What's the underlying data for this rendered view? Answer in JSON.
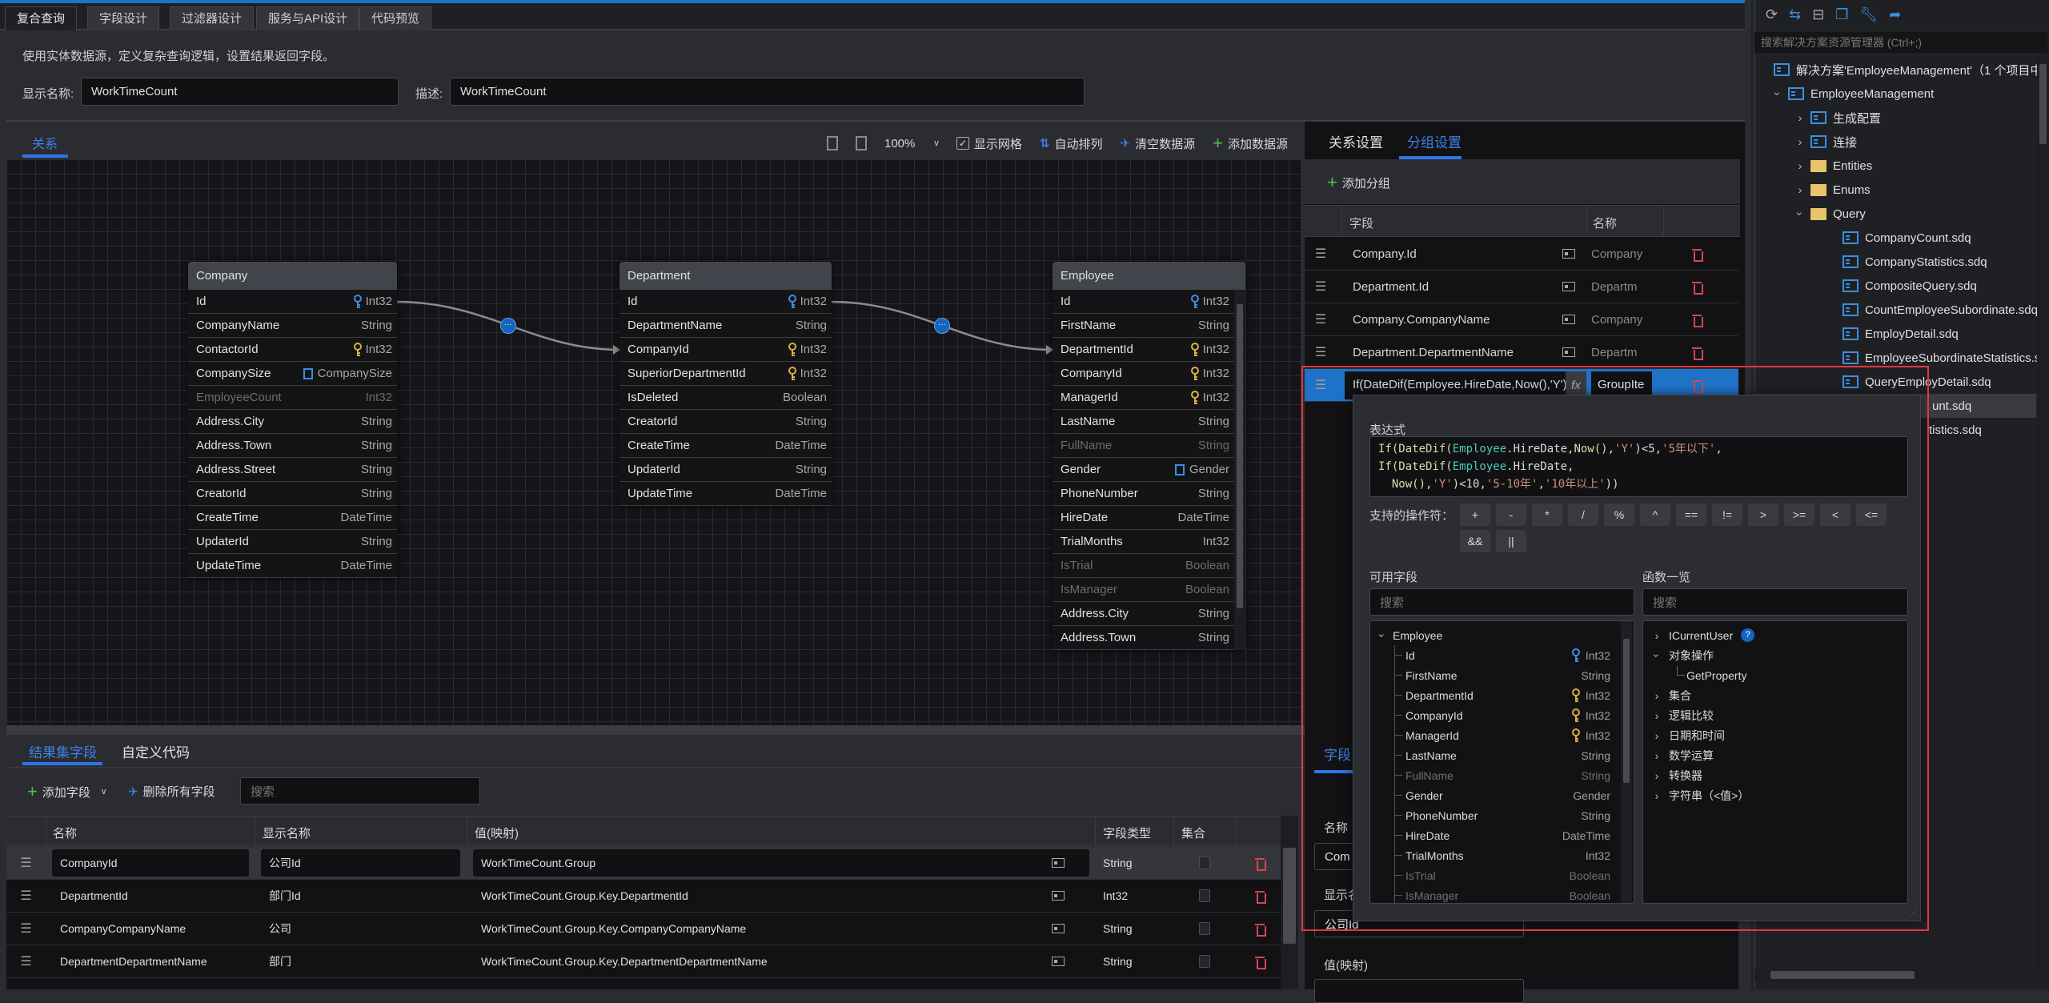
{
  "tabs": [
    "复合查询",
    "字段设计",
    "过滤器设计",
    "服务与API设计",
    "代码预览"
  ],
  "description": "使用实体数据源，定义复杂查询逻辑，设置结果返回字段。",
  "form": {
    "display_name_label": "显示名称:",
    "display_name_value": "WorkTimeCount",
    "desc_label": "描述:",
    "desc_value": "WorkTimeCount"
  },
  "canvas_toolbar": {
    "tab": "关系",
    "zoom": "100%",
    "show_grid": "显示网格",
    "show_grid_checked": true,
    "auto_arrange": "自动排列",
    "clear_sources": "清空数据源",
    "add_source": "添加数据源"
  },
  "entities": [
    {
      "title": "Company",
      "rows": [
        {
          "n": "Id",
          "t": "Int32",
          "i": "pk"
        },
        {
          "n": "CompanyName",
          "t": "String"
        },
        {
          "n": "ContactorId",
          "t": "Int32",
          "i": "fk"
        },
        {
          "n": "CompanySize",
          "t": "CompanySize",
          "i": "enum"
        },
        {
          "n": "EmployeeCount",
          "t": "Int32",
          "dim": true
        },
        {
          "n": "Address.City",
          "t": "String"
        },
        {
          "n": "Address.Town",
          "t": "String"
        },
        {
          "n": "Address.Street",
          "t": "String"
        },
        {
          "n": "CreatorId",
          "t": "String"
        },
        {
          "n": "CreateTime",
          "t": "DateTime"
        },
        {
          "n": "UpdaterId",
          "t": "String"
        },
        {
          "n": "UpdateTime",
          "t": "DateTime"
        }
      ]
    },
    {
      "title": "Department",
      "rows": [
        {
          "n": "Id",
          "t": "Int32",
          "i": "pk"
        },
        {
          "n": "DepartmentName",
          "t": "String"
        },
        {
          "n": "CompanyId",
          "t": "Int32",
          "i": "fk"
        },
        {
          "n": "SuperiorDepartmentId",
          "t": "Int32",
          "i": "fk"
        },
        {
          "n": "IsDeleted",
          "t": "Boolean"
        },
        {
          "n": "CreatorId",
          "t": "String"
        },
        {
          "n": "CreateTime",
          "t": "DateTime"
        },
        {
          "n": "UpdaterId",
          "t": "String"
        },
        {
          "n": "UpdateTime",
          "t": "DateTime"
        }
      ]
    },
    {
      "title": "Employee",
      "rows": [
        {
          "n": "Id",
          "t": "Int32",
          "i": "pk"
        },
        {
          "n": "FirstName",
          "t": "String"
        },
        {
          "n": "DepartmentId",
          "t": "Int32",
          "i": "fk"
        },
        {
          "n": "CompanyId",
          "t": "Int32",
          "i": "fk"
        },
        {
          "n": "ManagerId",
          "t": "Int32",
          "i": "fk"
        },
        {
          "n": "LastName",
          "t": "String"
        },
        {
          "n": "FullName",
          "t": "String",
          "dim": true
        },
        {
          "n": "Gender",
          "t": "Gender",
          "i": "enum"
        },
        {
          "n": "PhoneNumber",
          "t": "String"
        },
        {
          "n": "HireDate",
          "t": "DateTime"
        },
        {
          "n": "TrialMonths",
          "t": "Int32"
        },
        {
          "n": "IsTrial",
          "t": "Boolean",
          "dim": true
        },
        {
          "n": "IsManager",
          "t": "Boolean",
          "dim": true
        },
        {
          "n": "Address.City",
          "t": "String"
        },
        {
          "n": "Address.Town",
          "t": "String"
        }
      ]
    }
  ],
  "group_panel": {
    "tabs": [
      "关系设置",
      "分组设置"
    ],
    "add_group": "添加分组",
    "headers": {
      "field": "字段",
      "name": "名称"
    },
    "rows": [
      {
        "field": "Company.Id",
        "name": "Company"
      },
      {
        "field": "Department.Id",
        "name": "Departm"
      },
      {
        "field": "Company.CompanyName",
        "name": "Company"
      },
      {
        "field": "Department.DepartmentName",
        "name": "Departm"
      },
      {
        "field": "If(DateDif(Employee.HireDate,Now(),'Y')<",
        "name": "GroupIte",
        "fx": "fx",
        "selected": true
      }
    ]
  },
  "field_panel": {
    "tab": "字段",
    "name_label": "名称",
    "name_value": "Com",
    "display_label": "显示名",
    "display_value": "公司Id",
    "value_label": "值(映射)"
  },
  "expression_popup": {
    "label": "表达式",
    "tokens": [
      {
        "t": "If(DateDif(",
        "c": "fn"
      },
      {
        "t": "Employee",
        "c": "ent"
      },
      {
        "t": ".HireDate,",
        "c": "op"
      },
      {
        "t": "Now()",
        "c": "fn"
      },
      {
        "t": ",",
        "c": "op"
      },
      {
        "t": "'Y'",
        "c": "str"
      },
      {
        "t": ")<5,",
        "c": "op"
      },
      {
        "t": "'5年以下'",
        "c": "str"
      },
      {
        "t": ", ",
        "c": "op"
      },
      {
        "t": "If(DateDif(",
        "c": "fn"
      },
      {
        "t": "Employee",
        "c": "ent"
      },
      {
        "t": ".HireDate,\n  ",
        "c": "op"
      },
      {
        "t": "Now()",
        "c": "fn"
      },
      {
        "t": ",",
        "c": "op"
      },
      {
        "t": "'Y'",
        "c": "str"
      },
      {
        "t": ")<10,",
        "c": "op"
      },
      {
        "t": "'5-10年'",
        "c": "str"
      },
      {
        "t": ",",
        "c": "op"
      },
      {
        "t": "'10年以上'",
        "c": "str"
      },
      {
        "t": "))",
        "c": "op"
      }
    ],
    "operators_label": "支持的操作符：",
    "operators": [
      "+",
      "-",
      "*",
      "/",
      "%",
      "^",
      "==",
      "!=",
      ">",
      ">=",
      "<",
      "<=",
      "&&",
      "||"
    ],
    "fields_label": "可用字段",
    "functions_label": "函数一览",
    "search_placeholder": "搜索",
    "field_root": "Employee",
    "fields": [
      {
        "n": "Id",
        "t": "Int32",
        "i": "pk"
      },
      {
        "n": "FirstName",
        "t": "String"
      },
      {
        "n": "DepartmentId",
        "t": "Int32",
        "i": "fk"
      },
      {
        "n": "CompanyId",
        "t": "Int32",
        "i": "fk"
      },
      {
        "n": "ManagerId",
        "t": "Int32",
        "i": "fk"
      },
      {
        "n": "LastName",
        "t": "String"
      },
      {
        "n": "FullName",
        "t": "String",
        "dim": true
      },
      {
        "n": "Gender",
        "t": "Gender"
      },
      {
        "n": "PhoneNumber",
        "t": "String"
      },
      {
        "n": "HireDate",
        "t": "DateTime"
      },
      {
        "n": "TrialMonths",
        "t": "Int32"
      },
      {
        "n": "IsTrial",
        "t": "Boolean",
        "dim": true
      },
      {
        "n": "IsManager",
        "t": "Boolean",
        "dim": true
      }
    ],
    "functions": [
      {
        "n": "ICurrentUser",
        "help": "?"
      },
      {
        "n": "对象操作",
        "open": true,
        "children": [
          "GetProperty"
        ]
      },
      {
        "n": "集合"
      },
      {
        "n": "逻辑比较"
      },
      {
        "n": "日期和时间"
      },
      {
        "n": "数学运算"
      },
      {
        "n": "转换器"
      },
      {
        "n": "字符串（<值>）"
      }
    ]
  },
  "result_panel": {
    "tabs": [
      "结果集字段",
      "自定义代码"
    ],
    "add_field": "添加字段",
    "delete_all": "删除所有字段",
    "search_placeholder": "搜索",
    "headers": [
      "名称",
      "显示名称",
      "值(映射)",
      "字段类型",
      "集合"
    ],
    "rows": [
      {
        "name": "CompanyId",
        "display": "公司Id",
        "value": "WorkTimeCount.Group",
        "type": "String",
        "selected": true
      },
      {
        "name": "DepartmentId",
        "display": "部门Id",
        "value": "WorkTimeCount.Group.Key.DepartmentId",
        "type": "Int32"
      },
      {
        "name": "CompanyCompanyName",
        "display": "公司",
        "value": "WorkTimeCount.Group.Key.CompanyCompanyName",
        "type": "String"
      },
      {
        "name": "DepartmentDepartmentName",
        "display": "部门",
        "value": "WorkTimeCount.Group.Key.DepartmentDepartmentName",
        "type": "String"
      }
    ]
  },
  "solution_explorer": {
    "search_placeholder": "搜索解决方案资源管理器 (Ctrl+;)",
    "items": [
      {
        "label": "解决方案'EmployeeManagement'（1 个项目中的",
        "level": 0,
        "icon": "solution"
      },
      {
        "label": "EmployeeManagement",
        "level": 1,
        "icon": "project",
        "chev": "open"
      },
      {
        "label": "生成配置",
        "level": 2,
        "icon": "build",
        "chev": "closed"
      },
      {
        "label": "连接",
        "level": 2,
        "icon": "connection",
        "chev": "closed"
      },
      {
        "label": "Entities",
        "level": 2,
        "icon": "folder",
        "chev": "closed"
      },
      {
        "label": "Enums",
        "level": 2,
        "icon": "folder",
        "chev": "closed"
      },
      {
        "label": "Query",
        "level": 2,
        "icon": "folder-open",
        "chev": "open"
      },
      {
        "label": "CompanyCount.sdq",
        "level": 3,
        "icon": "query-file"
      },
      {
        "label": "CompanyStatistics.sdq",
        "level": 3,
        "icon": "query-file"
      },
      {
        "label": "CompositeQuery.sdq",
        "level": 3,
        "icon": "query-file"
      },
      {
        "label": "CountEmployeeSubordinate.sdq",
        "level": 3,
        "icon": "query-file"
      },
      {
        "label": "EmployDetail.sdq",
        "level": 3,
        "icon": "query-file"
      },
      {
        "label": "EmployeeSubordinateStatistics.sdq",
        "level": 3,
        "icon": "query-file"
      },
      {
        "label": "QueryEmployDetail.sdq",
        "level": 3,
        "icon": "query-file"
      },
      {
        "label": "unt.sdq",
        "level": 3,
        "icon": "query-file",
        "selected": true,
        "partial": true
      },
      {
        "label": "tistics.sdq",
        "level": 3,
        "icon": "query-file",
        "partial": true
      }
    ]
  },
  "colors": {
    "accent": "#2f74e6",
    "danger": "#d9464a",
    "highlight_border": "#e0383e",
    "pk_key": "#3d8ee0",
    "fk_key": "#d9b040"
  }
}
